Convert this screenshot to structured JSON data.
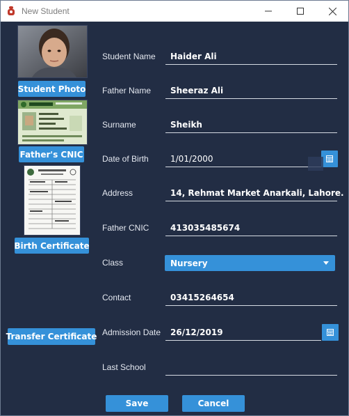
{
  "window": {
    "title": "New Student"
  },
  "side": {
    "student_photo_label": "Student Photo",
    "father_cnic_label": "Father's CNIC",
    "birth_certificate_label": "Birth Certificate",
    "transfer_certificate_label": "Transfer Certificate"
  },
  "form": {
    "student_name": {
      "label": "Student Name",
      "value": "Haider Ali"
    },
    "father_name": {
      "label": "Father Name",
      "value": "Sheeraz Ali"
    },
    "surname": {
      "label": "Surname",
      "value": "Sheikh"
    },
    "dob": {
      "label": "Date of Birth",
      "value": "1/01/2000"
    },
    "address": {
      "label": "Address",
      "value": "14, Rehmat Market Anarkali, Lahore."
    },
    "father_cnic": {
      "label": "Father CNIC",
      "value": "413035485674"
    },
    "class": {
      "label": "Class",
      "value": "Nursery"
    },
    "contact": {
      "label": "Contact",
      "value": "03415264654"
    },
    "admission_date": {
      "label": "Admission Date",
      "value": "26/12/2019"
    },
    "last_school": {
      "label": "Last School",
      "value": ""
    }
  },
  "actions": {
    "save_label": "Save",
    "cancel_label": "Cancel"
  },
  "colors": {
    "background": "#222d44",
    "accent": "#3591d9",
    "titlebar": "#ffffff"
  },
  "icons": {
    "app": "app-icon",
    "minimize": "minimize-icon",
    "maximize": "maximize-icon",
    "close": "close-icon",
    "calendar": "calendar-icon",
    "dropdown": "chevron-down-icon"
  }
}
